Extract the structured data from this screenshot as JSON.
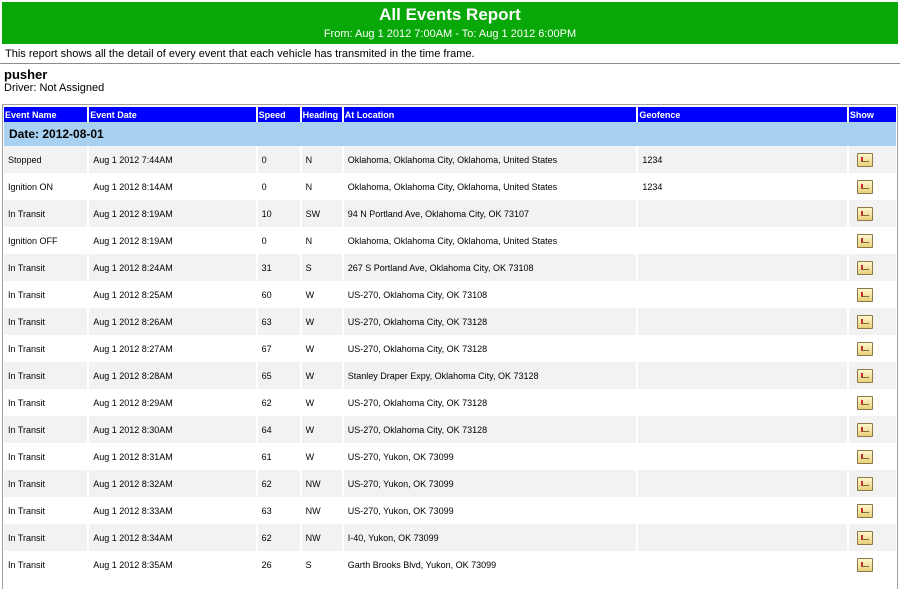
{
  "report": {
    "title": "All Events Report",
    "range": "From: Aug 1 2012 7:00AM - To: Aug 1 2012 6:00PM",
    "intro": "This report shows all the detail of every event that each vehicle has transmited in the time frame.",
    "vehicle": "pusher",
    "driver": "Driver: Not Assigned"
  },
  "columns": [
    "Event Name",
    "Event Date",
    "Speed",
    "Heading",
    "At Location",
    "Geofence",
    "Show"
  ],
  "date_group": "Date: 2012-08-01",
  "rows": [
    {
      "event": "Stopped",
      "date": "Aug 1 2012 7:44AM",
      "speed": "0",
      "heading": "N",
      "location": "Oklahoma, Oklahoma City, Oklahoma, United States",
      "geofence": "1234"
    },
    {
      "event": "Ignition ON",
      "date": "Aug 1 2012 8:14AM",
      "speed": "0",
      "heading": "N",
      "location": "Oklahoma, Oklahoma City, Oklahoma, United States",
      "geofence": "1234"
    },
    {
      "event": "In Transit",
      "date": "Aug 1 2012 8:19AM",
      "speed": "10",
      "heading": "SW",
      "location": "94 N Portland Ave, Oklahoma City, OK 73107",
      "geofence": ""
    },
    {
      "event": "Ignition OFF",
      "date": "Aug 1 2012 8:19AM",
      "speed": "0",
      "heading": "N",
      "location": "Oklahoma, Oklahoma City, Oklahoma, United States",
      "geofence": ""
    },
    {
      "event": "In Transit",
      "date": "Aug 1 2012 8:24AM",
      "speed": "31",
      "heading": "S",
      "location": "267 S Portland Ave, Oklahoma City, OK 73108",
      "geofence": ""
    },
    {
      "event": "In Transit",
      "date": "Aug 1 2012 8:25AM",
      "speed": "60",
      "heading": "W",
      "location": "US-270, Oklahoma City, OK 73108",
      "geofence": ""
    },
    {
      "event": "In Transit",
      "date": "Aug 1 2012 8:26AM",
      "speed": "63",
      "heading": "W",
      "location": "US-270, Oklahoma City, OK 73128",
      "geofence": ""
    },
    {
      "event": "In Transit",
      "date": "Aug 1 2012 8:27AM",
      "speed": "67",
      "heading": "W",
      "location": "US-270, Oklahoma City, OK 73128",
      "geofence": ""
    },
    {
      "event": "In Transit",
      "date": "Aug 1 2012 8:28AM",
      "speed": "65",
      "heading": "W",
      "location": "Stanley Draper Expy, Oklahoma City, OK 73128",
      "geofence": ""
    },
    {
      "event": "In Transit",
      "date": "Aug 1 2012 8:29AM",
      "speed": "62",
      "heading": "W",
      "location": "US-270, Oklahoma City, OK 73128",
      "geofence": ""
    },
    {
      "event": "In Transit",
      "date": "Aug 1 2012 8:30AM",
      "speed": "64",
      "heading": "W",
      "location": "US-270, Oklahoma City, OK 73128",
      "geofence": ""
    },
    {
      "event": "In Transit",
      "date": "Aug 1 2012 8:31AM",
      "speed": "61",
      "heading": "W",
      "location": "US-270, Yukon, OK 73099",
      "geofence": ""
    },
    {
      "event": "In Transit",
      "date": "Aug 1 2012 8:32AM",
      "speed": "62",
      "heading": "NW",
      "location": "US-270, Yukon, OK 73099",
      "geofence": ""
    },
    {
      "event": "In Transit",
      "date": "Aug 1 2012 8:33AM",
      "speed": "63",
      "heading": "NW",
      "location": "US-270, Yukon, OK 73099",
      "geofence": ""
    },
    {
      "event": "In Transit",
      "date": "Aug 1 2012 8:34AM",
      "speed": "62",
      "heading": "NW",
      "location": "I-40, Yukon, OK 73099",
      "geofence": ""
    },
    {
      "event": "In Transit",
      "date": "Aug 1 2012 8:35AM",
      "speed": "26",
      "heading": "S",
      "location": "Garth Brooks Blvd, Yukon, OK 73099",
      "geofence": ""
    }
  ],
  "icons": {
    "show": "map-icon"
  }
}
